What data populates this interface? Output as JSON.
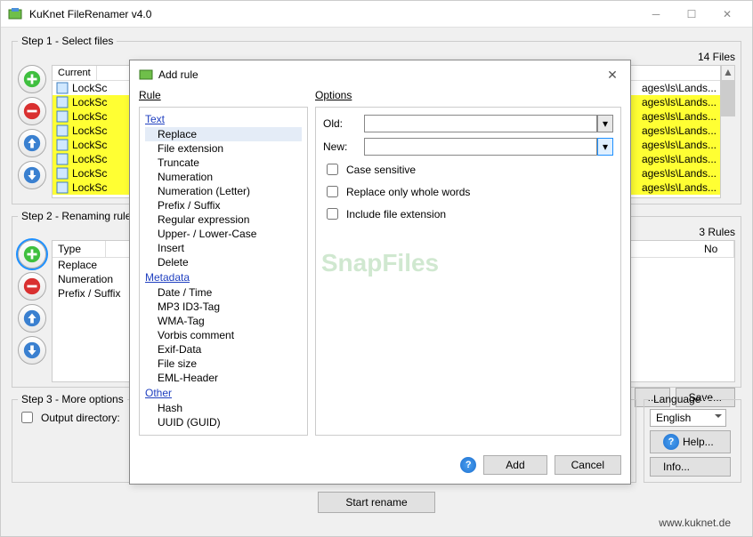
{
  "window": {
    "title": "KuKnet FileRenamer v4.0"
  },
  "step1": {
    "legend": "Step 1 - Select files",
    "count_label": "14 Files",
    "headers": {
      "current": "Current",
      "path_suffix": "ages\\ls\\Lands..."
    },
    "rows": [
      {
        "name": "LockSc",
        "selected": false
      },
      {
        "name": "LockSc",
        "selected": true
      },
      {
        "name": "LockSc",
        "selected": true
      },
      {
        "name": "LockSc",
        "selected": true
      },
      {
        "name": "LockSc",
        "selected": true
      },
      {
        "name": "LockSc",
        "selected": true
      },
      {
        "name": "LockSc",
        "selected": true
      },
      {
        "name": "LockSc",
        "selected": true
      }
    ]
  },
  "step2": {
    "legend": "Step 2 - Renaming rules",
    "count_label": "3 Rules",
    "headers": {
      "type": "Type",
      "no": "No"
    },
    "rules": [
      "Replace",
      "Numeration",
      "Prefix / Suffix"
    ],
    "save_btn": "Save...",
    "ellipsis_btn": "..."
  },
  "step3": {
    "legend": "Step 3 - More options",
    "output_dir": "Output directory:"
  },
  "right": {
    "language_label": "Language",
    "language_value": "English",
    "help": "Help...",
    "info": "Info..."
  },
  "start_btn": "Start rename",
  "footer_url": "www.kuknet.de",
  "dialog": {
    "title": "Add rule",
    "rule_hdr": "Rule",
    "options_hdr": "Options",
    "cat_text": "Text",
    "cat_metadata": "Metadata",
    "cat_other": "Other",
    "items_text": [
      "Replace",
      "File extension",
      "Truncate",
      "Numeration",
      "Numeration (Letter)",
      "Prefix / Suffix",
      "Regular expression",
      "Upper- / Lower-Case",
      "Insert",
      "Delete"
    ],
    "items_metadata": [
      "Date / Time",
      "MP3 ID3-Tag",
      "WMA-Tag",
      "Vorbis comment",
      "Exif-Data",
      "File size",
      "EML-Header"
    ],
    "items_other": [
      "Hash",
      "UUID (GUID)"
    ],
    "old_label": "Old:",
    "new_label": "New:",
    "old_value": "",
    "new_value": "",
    "cb_case": "Case sensitive",
    "cb_whole": "Replace only whole words",
    "cb_ext": "Include file extension",
    "add": "Add",
    "cancel": "Cancel"
  },
  "watermark": "SnapFiles"
}
